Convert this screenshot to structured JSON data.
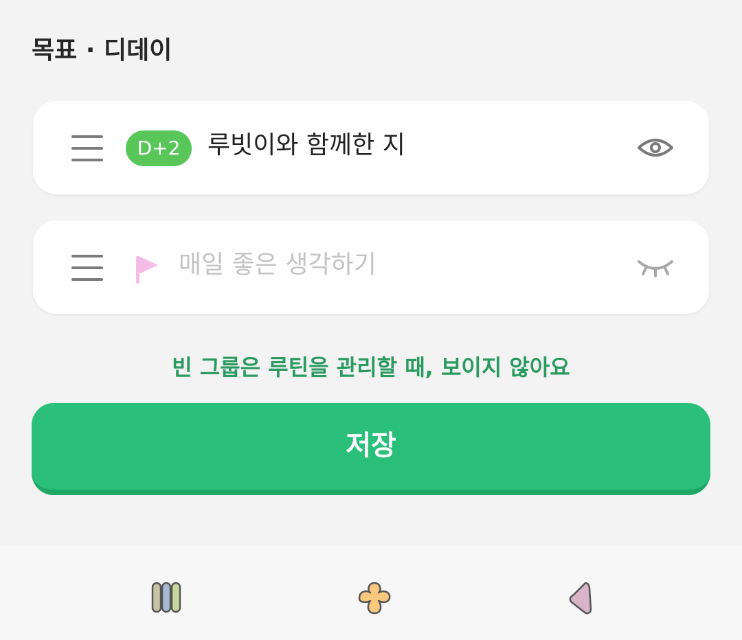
{
  "header": {
    "title": "목표 · 디데이"
  },
  "groups": [
    {
      "badge": "D+2",
      "title": "루빗이와 함께한 지",
      "visibility_icon": "eye-icon",
      "badge_color": "#59c65a"
    },
    {
      "flag_icon": "flag-icon",
      "placeholder": "매일 좋은 생각하기",
      "visibility_icon": "eye-closed-icon",
      "flag_color": "#f4bde6"
    }
  ],
  "hint": "빈 그룹은 루틴을 관리할 때, 보이지 않아요",
  "save_label": "저장",
  "colors": {
    "accent": "#2bbf7c",
    "hint": "#2a9a60"
  },
  "bottom_nav": [
    {
      "icon": "pills-icon"
    },
    {
      "icon": "flower-icon"
    },
    {
      "icon": "triangle-icon"
    }
  ]
}
